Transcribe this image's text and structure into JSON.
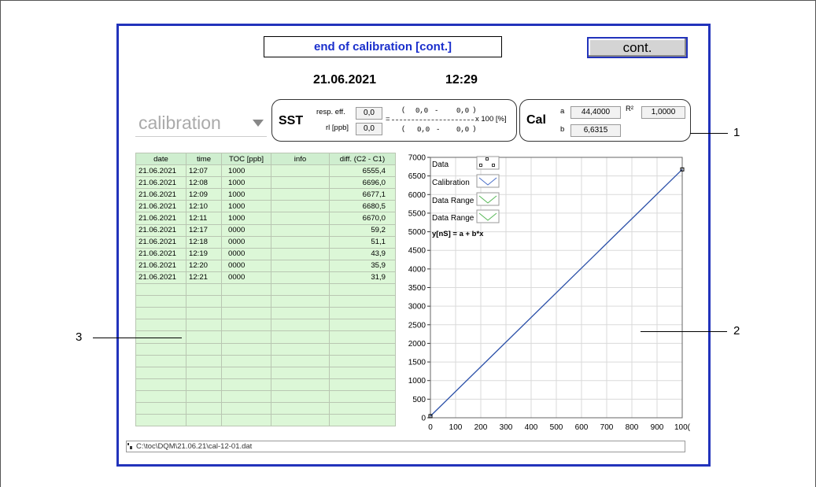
{
  "header": {
    "title": "end of calibration [cont.]",
    "cont_button": "cont.",
    "date": "21.06.2021",
    "time": "12:29"
  },
  "mode_select": {
    "value": "calibration"
  },
  "sst": {
    "label": "SST",
    "resp_eff_label": "resp. eff.",
    "resp_eff_value": "0,0",
    "rl_label": "rl [ppb]",
    "rl_value": "0,0",
    "formula_open1": "(",
    "formula_num1a": "0,0",
    "formula_dash1": "-",
    "formula_num1b": "0,0",
    "formula_close1": ")",
    "formula_eq": "=",
    "formula_mult": "x 100 [%]",
    "formula_open2": "(",
    "formula_num2a": "0,0",
    "formula_dash2": "-",
    "formula_num2b": "0,0",
    "formula_close2": ")"
  },
  "cal": {
    "label": "Cal",
    "a_label": "a",
    "a_value": "44,4000",
    "r2_label": "R²",
    "r2_value": "1,0000",
    "b_label": "b",
    "b_value": "6,6315"
  },
  "table": {
    "headers": [
      "date",
      "time",
      "TOC [ppb]",
      "info",
      "diff. (C2 - C1)"
    ],
    "rows": [
      [
        "21.06.2021",
        "12:07",
        "1000",
        "",
        "6555,4"
      ],
      [
        "21.06.2021",
        "12:08",
        "1000",
        "",
        "6696,0"
      ],
      [
        "21.06.2021",
        "12:09",
        "1000",
        "",
        "6677,1"
      ],
      [
        "21.06.2021",
        "12:10",
        "1000",
        "",
        "6680,5"
      ],
      [
        "21.06.2021",
        "12:11",
        "1000",
        "",
        "6670,0"
      ],
      [
        "21.06.2021",
        "12:17",
        "0000",
        "",
        "59,2"
      ],
      [
        "21.06.2021",
        "12:18",
        "0000",
        "",
        "51,1"
      ],
      [
        "21.06.2021",
        "12:19",
        "0000",
        "",
        "43,9"
      ],
      [
        "21.06.2021",
        "12:20",
        "0000",
        "",
        "35,9"
      ],
      [
        "21.06.2021",
        "12:21",
        "0000",
        "",
        "31,9"
      ]
    ],
    "empty_rows": 12
  },
  "legend": {
    "data": "Data",
    "calibration": "Calibration",
    "data_range_1": "Data Range",
    "data_range_2": "Data Range",
    "formula": "y[nS] = a + b*x"
  },
  "chart_data": {
    "type": "line",
    "xlim": [
      0,
      1000
    ],
    "ylim": [
      0,
      7000
    ],
    "x_ticks": [
      "0",
      "100",
      "200",
      "300",
      "400",
      "500",
      "600",
      "700",
      "800",
      "900",
      "100("
    ],
    "y_ticks": [
      "0",
      "500",
      "1000",
      "1500",
      "2000",
      "2500",
      "3000",
      "3500",
      "4000",
      "4500",
      "5000",
      "5500",
      "6000",
      "6500",
      "7000"
    ],
    "grid": true,
    "legend_position": "top-left",
    "series": [
      {
        "name": "Calibration",
        "type": "line",
        "x": [
          0,
          1000
        ],
        "y": [
          44.4,
          6675.9
        ],
        "color": "#2a4fa8"
      },
      {
        "name": "Data",
        "type": "scatter",
        "x": [
          0,
          1000
        ],
        "y": [
          44.4,
          6675.9
        ],
        "color": "#000000"
      }
    ]
  },
  "footer": {
    "file_path": "C:\\toc\\DQM\\21.06.21\\cal-12-01.dat"
  },
  "callouts": [
    "1",
    "2",
    "3"
  ],
  "colors": {
    "frame_blue": "#2233bb",
    "title_blue": "#1a2fcc",
    "table_green": "#dcf7d7",
    "line_blue": "#2a4fa8"
  }
}
